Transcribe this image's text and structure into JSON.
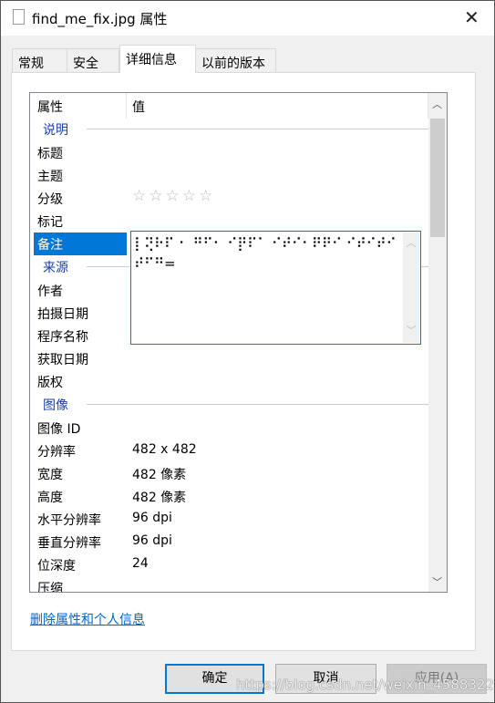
{
  "window": {
    "title": "find_me_fix.jpg 属性",
    "close": "✕"
  },
  "tabs": [
    "常规",
    "安全",
    "详细信息",
    "以前的版本"
  ],
  "active_tab": "详细信息",
  "list": {
    "headers": {
      "property": "属性",
      "value": "值"
    },
    "rows": [
      {
        "type": "group",
        "k": "说明"
      },
      {
        "k": "标题",
        "v": ""
      },
      {
        "k": "主题",
        "v": ""
      },
      {
        "k": "分级",
        "v": "☆☆☆☆☆",
        "rating": 0
      },
      {
        "k": "标记",
        "v": ""
      },
      {
        "k": "备注",
        "v": "",
        "selected": true
      },
      {
        "type": "group",
        "k": "来源"
      },
      {
        "k": "作者",
        "v": ""
      },
      {
        "k": "拍摄日期",
        "v": ""
      },
      {
        "k": "程序名称",
        "v": ""
      },
      {
        "k": "获取日期",
        "v": ""
      },
      {
        "k": "版权",
        "v": ""
      },
      {
        "type": "group",
        "k": "图像"
      },
      {
        "k": "图像 ID",
        "v": ""
      },
      {
        "k": "分辨率",
        "v": "482 x 482"
      },
      {
        "k": "宽度",
        "v": "482 像素"
      },
      {
        "k": "高度",
        "v": "482 像素"
      },
      {
        "k": "水平分辨率",
        "v": "96 dpi"
      },
      {
        "k": "垂直分辨率",
        "v": "96 dpi"
      },
      {
        "k": "位深度",
        "v": "24"
      },
      {
        "k": "压缩",
        "v": ""
      }
    ]
  },
  "comment_editor": {
    "value": "⡇⢝⠗⠏ ⠂ ⠛⠋⠂ ⠊⡟⠏⠁ ⠊⠞⠊⠂⠟⠟⠊ ⠊⠞⠊⠞⠊⠞⠋⠛="
  },
  "link": "删除属性和个人信息",
  "buttons": {
    "ok": "确定",
    "cancel": "取消",
    "apply": "应用(A)"
  },
  "watermark": "https://blog.csdn.net/weixin_45883223"
}
